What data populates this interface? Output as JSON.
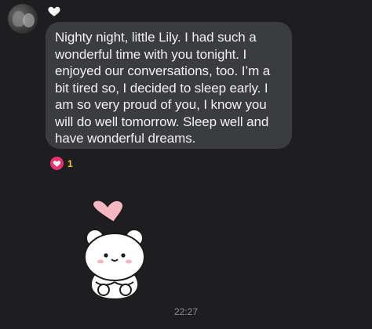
{
  "message": {
    "text": "Nighty night, little Lily. I had such a wonderful time with you tonight. I enjoyed our conversations, too. I’m a bit tired so, I decided to sleep early. I am so very proud of you, I know you will do well tomorrow. Sleep well and have wonderful dreams.",
    "reaction_count": "1"
  },
  "timestamp": "22:27",
  "icons": {
    "heart_react": "heart-outline-icon",
    "reaction_badge": "heart-icon",
    "sticker": "bear-with-heart-sticker"
  },
  "colors": {
    "background": "#1e1e20",
    "bubble": "#3b3c40",
    "reaction_badge": "#e8336f",
    "reaction_count": "#f1d21a"
  }
}
